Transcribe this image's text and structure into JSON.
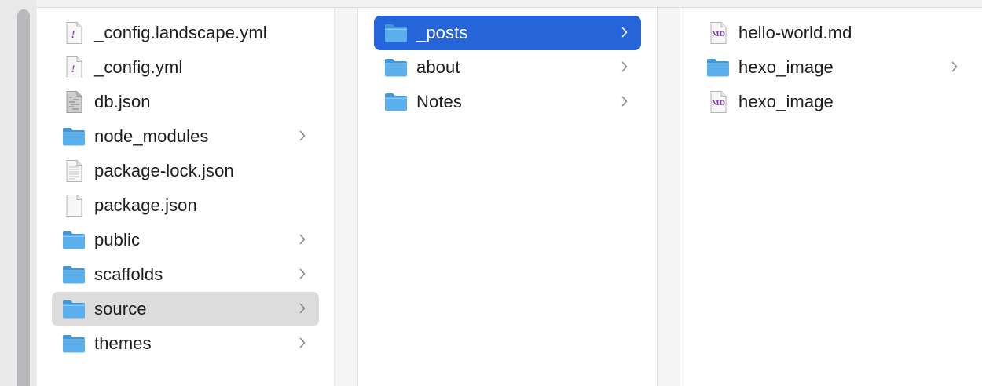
{
  "colors": {
    "selection_blue": "#2664d9",
    "selection_gray": "#dcdcdc",
    "folder_blue": "#5aafec",
    "md_purple": "#7b3fa3"
  },
  "columns": [
    {
      "items": [
        {
          "name": "_config.landscape.yml",
          "icon": "yml-file-icon",
          "has_children": false,
          "state": "normal"
        },
        {
          "name": "_config.yml",
          "icon": "yml-file-icon",
          "has_children": false,
          "state": "normal"
        },
        {
          "name": "db.json",
          "icon": "json-db-file-icon",
          "has_children": false,
          "state": "normal"
        },
        {
          "name": "node_modules",
          "icon": "folder-icon",
          "has_children": true,
          "state": "normal"
        },
        {
          "name": "package-lock.json",
          "icon": "text-file-icon",
          "has_children": false,
          "state": "normal"
        },
        {
          "name": "package.json",
          "icon": "blank-file-icon",
          "has_children": false,
          "state": "normal"
        },
        {
          "name": "public",
          "icon": "folder-icon",
          "has_children": true,
          "state": "normal"
        },
        {
          "name": "scaffolds",
          "icon": "folder-icon",
          "has_children": true,
          "state": "normal"
        },
        {
          "name": "source",
          "icon": "folder-icon",
          "has_children": true,
          "state": "selected-inactive"
        },
        {
          "name": "themes",
          "icon": "folder-icon",
          "has_children": true,
          "state": "normal"
        }
      ]
    },
    {
      "items": [
        {
          "name": "_posts",
          "icon": "folder-icon",
          "has_children": true,
          "state": "selected-active"
        },
        {
          "name": "about",
          "icon": "folder-icon",
          "has_children": true,
          "state": "normal"
        },
        {
          "name": "Notes",
          "icon": "folder-icon",
          "has_children": true,
          "state": "normal"
        }
      ]
    },
    {
      "items": [
        {
          "name": "hello-world.md",
          "icon": "markdown-file-icon",
          "has_children": false,
          "state": "normal"
        },
        {
          "name": "hexo_image",
          "icon": "folder-icon",
          "has_children": true,
          "state": "normal"
        },
        {
          "name": "hexo_image",
          "icon": "markdown-file-icon",
          "has_children": false,
          "state": "normal"
        }
      ]
    }
  ],
  "md_badge": "MD"
}
